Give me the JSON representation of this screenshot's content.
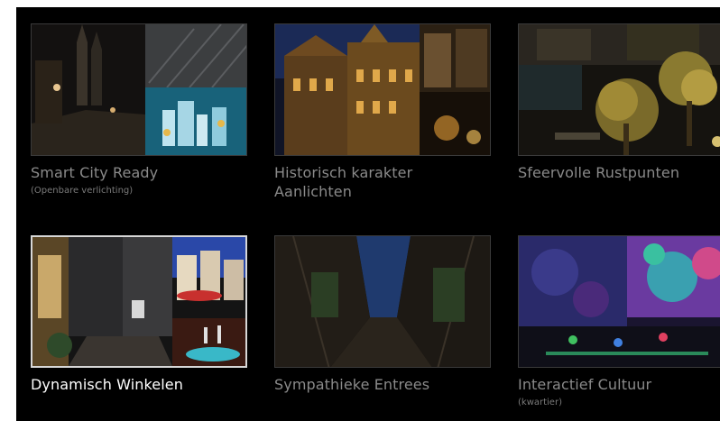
{
  "gallery": {
    "tiles": [
      {
        "title": "Smart City Ready",
        "subtitle": "(Openbare verlichting)",
        "active": false,
        "thumb_icon": "street-night-collage-thumbnail"
      },
      {
        "title": "Historisch karakter",
        "title_line2": "Aanlichten",
        "active": false,
        "thumb_icon": "historic-buildings-thumbnail"
      },
      {
        "title": "Sfeervolle Rustpunten",
        "active": false,
        "thumb_icon": "lit-trees-square-thumbnail"
      },
      {
        "title": "Dynamisch Winkelen",
        "active": true,
        "thumb_icon": "shopping-street-thumbnail"
      },
      {
        "title": "Sympathieke Entrees",
        "active": false,
        "thumb_icon": "alley-entrance-thumbnail"
      },
      {
        "title": "Interactief Cultuur",
        "subtitle": "(kwartier)",
        "active": false,
        "thumb_icon": "interactive-light-thumbnail"
      }
    ]
  },
  "colors": {
    "background": "#000000",
    "caption_inactive": "#8a8a8a",
    "caption_active": "#ffffff",
    "active_border": "#d7d7d7"
  }
}
